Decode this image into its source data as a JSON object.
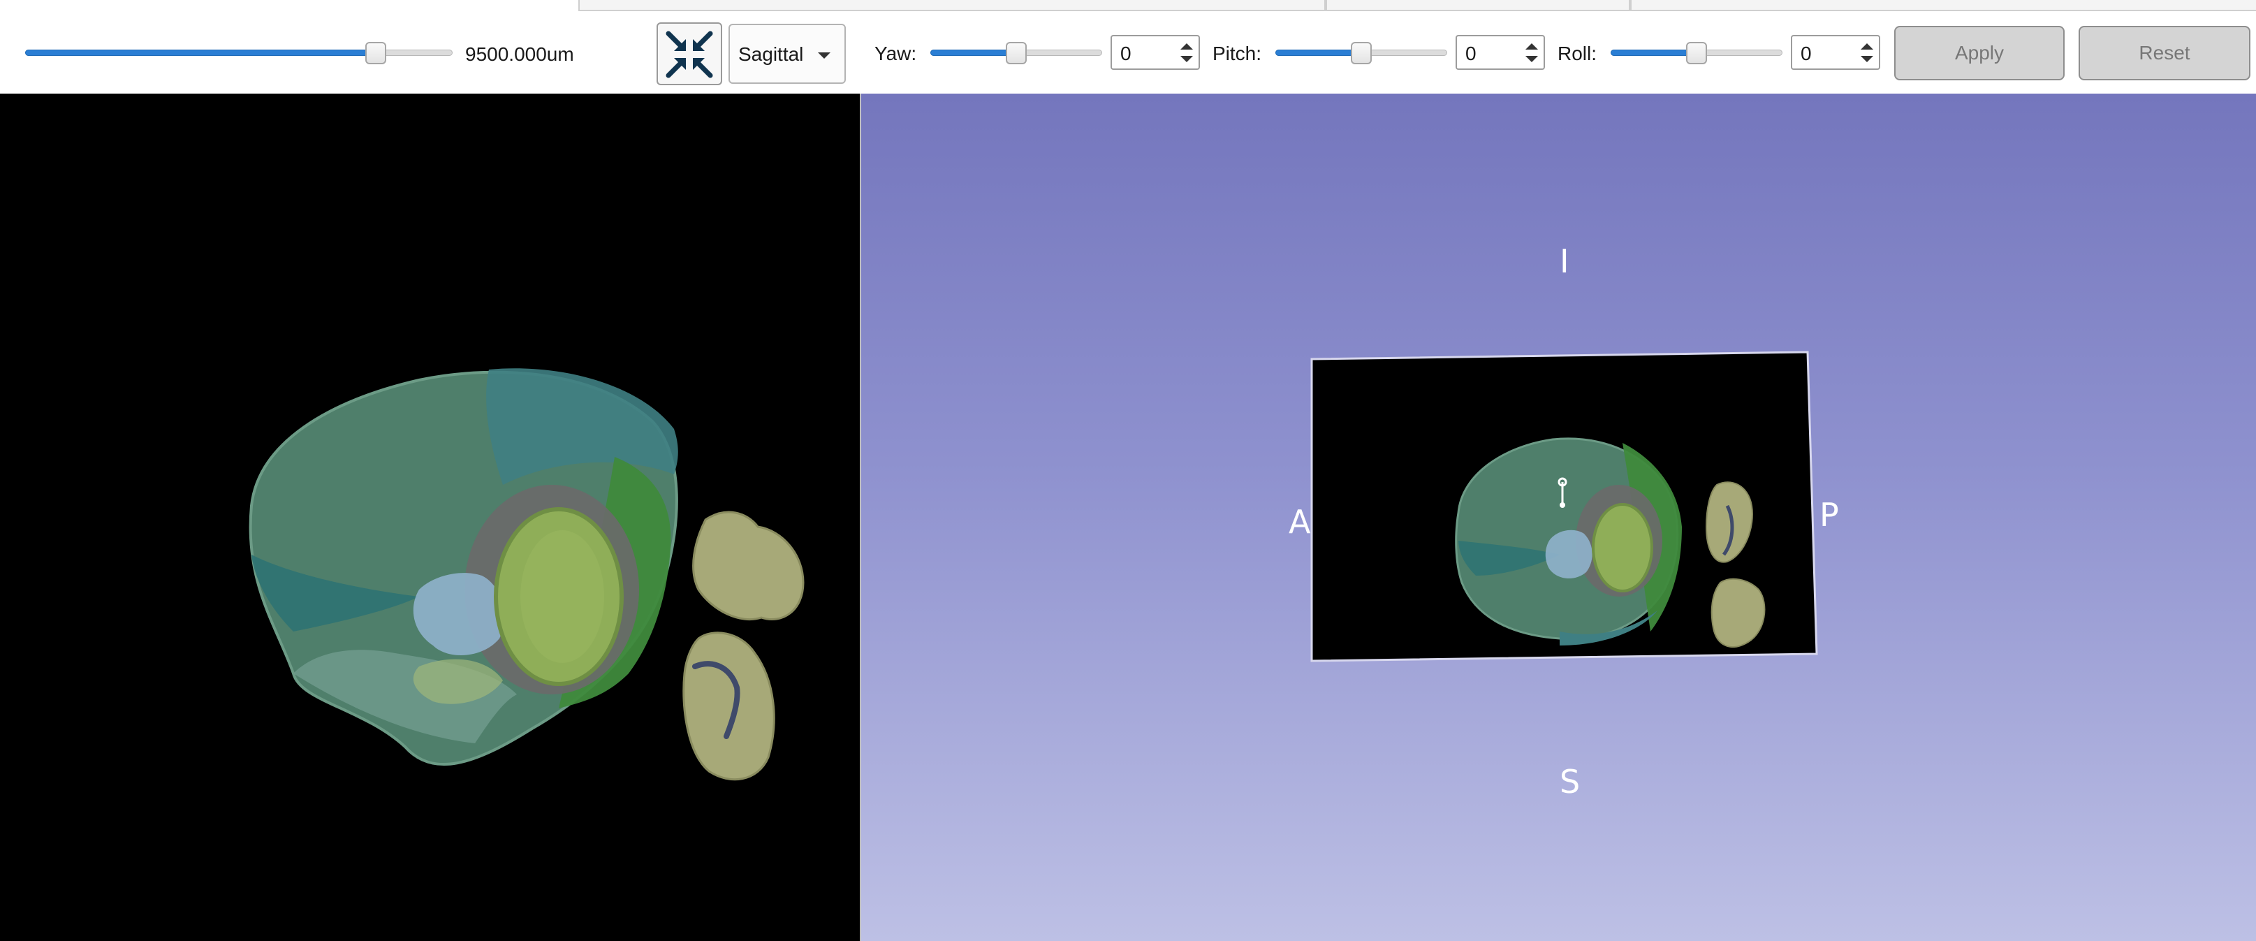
{
  "toolbar": {
    "zoom_slider": {
      "fraction": 0.82,
      "value_label": "9500.000um"
    },
    "fit_button_icon": "collapse-arrows-icon",
    "view_combo": {
      "selected": "Sagittal"
    },
    "yaw": {
      "label": "Yaw:",
      "value": "0",
      "fraction": 0.5
    },
    "pitch": {
      "label": "Pitch:",
      "value": "0",
      "fraction": 0.5
    },
    "roll": {
      "label": "Roll:",
      "value": "0",
      "fraction": 0.5
    },
    "apply_label": "Apply",
    "reset_label": "Reset"
  },
  "viewer_3d": {
    "orientation": {
      "top": "I",
      "bottom": "S",
      "left": "A",
      "right": "P"
    }
  },
  "colors": {
    "slider_fill": "#2a7ed4",
    "viewer_background_top": "#7476bd",
    "viewer_background_bottom": "#bdc0e5",
    "slice_background": "#000000"
  }
}
